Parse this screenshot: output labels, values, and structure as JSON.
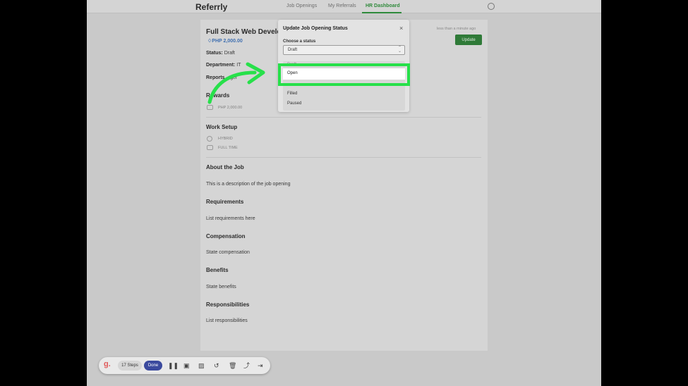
{
  "nav": {
    "brand": "Referrly",
    "links": [
      "Job Openings",
      "My Referrals",
      "HR Dashboard"
    ],
    "active": "HR Dashboard"
  },
  "job": {
    "title": "Full Stack Web Develop",
    "reward_amount": "PHP 2,000.00",
    "status_label": "Status:",
    "status_value": "Draft",
    "department_label": "Department:",
    "department_value": "IT",
    "reports_label": "Reports",
    "reports_value": "...ger",
    "updated": "less than a minute ago",
    "update_label": "Update",
    "rewards_heading": "Rewards",
    "reward_value": "PHP 2,000.00",
    "workset_heading": "Work Setup",
    "work_location": "HYBRID",
    "work_type": "FULL TIME",
    "about_heading": "About the Job",
    "about_text": "This is a description of the job opening",
    "req_heading": "Requirements",
    "req_text": "List requirements here",
    "comp_heading": "Compensation",
    "comp_text": "State compensation",
    "benefits_heading": "Benefits",
    "benefits_text": "State benefits",
    "resp_heading": "Responsibilities",
    "resp_text": "List responsibilities"
  },
  "modal": {
    "title": "Update Job Opening Status",
    "close_icon": "×",
    "choose_label": "Choose a status",
    "selected": "Draft",
    "options": {
      "draft": "Draft",
      "open": "Open",
      "filled": "Filled",
      "paused": "Paused"
    }
  },
  "toolbar": {
    "logo": "g.",
    "steps": "17 Steps",
    "done": "Done",
    "icons": [
      "pause-icon",
      "stop-icon",
      "image-icon",
      "undo-icon",
      "trash-icon",
      "share-icon",
      "skip-icon"
    ]
  },
  "colors": {
    "highlight": "#27e04a",
    "accent_green": "#2f8a3b",
    "done_blue": "#3b4a9e"
  }
}
